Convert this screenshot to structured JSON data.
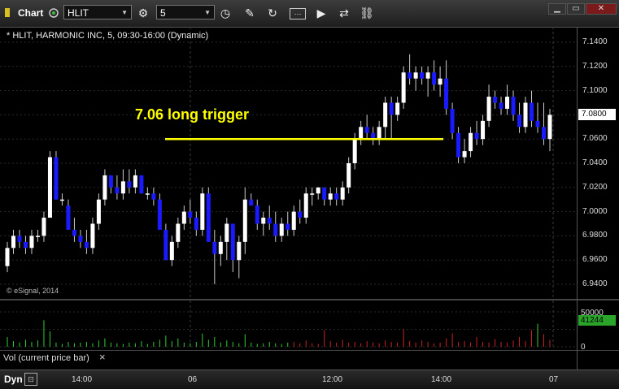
{
  "toolbar": {
    "app_label": "Chart",
    "symbol": "HLIT",
    "interval": "5",
    "icons": [
      "settings-icon",
      "clock-icon",
      "draw-icon",
      "refresh-icon",
      "studies-icon",
      "play-icon",
      "link-icon"
    ]
  },
  "chart": {
    "header": "* HLIT, HARMONIC INC, 5, 09:30-16:00 (Dynamic)",
    "annotation": "7.06 long trigger",
    "copyright": "© eSignal, 2014",
    "current_price": "7.0800",
    "price_ticks": [
      "7.1400",
      "7.1200",
      "7.1000",
      "7.0800",
      "7.0600",
      "7.0400",
      "7.0200",
      "7.0000",
      "6.9800",
      "6.9600",
      "6.9400"
    ],
    "time_ticks": [
      "14:00",
      "06",
      "12:00",
      "14:00",
      "07"
    ],
    "colors": {
      "up": "#ffffff",
      "down": "#1a1aff",
      "trigger": "#ffff00",
      "vol_up": "#33cc33",
      "vol_down": "#cc2222"
    }
  },
  "volume": {
    "label": "Vol (current price bar)",
    "close_symbol": "×",
    "scale_top": "50000",
    "scale_zero": "0",
    "current": "41244"
  },
  "footer": {
    "mode": "Dyn"
  },
  "chart_data": {
    "type": "candlestick",
    "price_range": [
      6.93,
      7.15
    ],
    "candles": [
      [
        6.955,
        6.975,
        6.95,
        6.97
      ],
      [
        6.97,
        6.985,
        6.965,
        6.98
      ],
      [
        6.98,
        6.985,
        6.97,
        6.975
      ],
      [
        6.975,
        6.98,
        6.965,
        6.97
      ],
      [
        6.97,
        6.985,
        6.965,
        6.98
      ],
      [
        6.98,
        6.985,
        6.975,
        6.98
      ],
      [
        6.98,
        7.0,
        6.975,
        6.995
      ],
      [
        6.995,
        7.05,
        6.995,
        7.045
      ],
      [
        7.045,
        7.05,
        7.01,
        7.01
      ],
      [
        7.01,
        7.015,
        7.005,
        7.01
      ],
      [
        7.005,
        7.01,
        6.985,
        6.985
      ],
      [
        6.985,
        6.995,
        6.975,
        6.98
      ],
      [
        6.98,
        6.985,
        6.97,
        6.975
      ],
      [
        6.975,
        6.985,
        6.965,
        6.97
      ],
      [
        6.97,
        6.995,
        6.965,
        6.99
      ],
      [
        6.99,
        7.015,
        6.985,
        7.01
      ],
      [
        7.01,
        7.035,
        7.005,
        7.03
      ],
      [
        7.03,
        7.03,
        7.015,
        7.02
      ],
      [
        7.02,
        7.03,
        7.01,
        7.015
      ],
      [
        7.015,
        7.035,
        7.01,
        7.025
      ],
      [
        7.025,
        7.035,
        7.015,
        7.02
      ],
      [
        7.02,
        7.035,
        7.015,
        7.03
      ],
      [
        7.03,
        7.03,
        7.015,
        7.015
      ],
      [
        7.015,
        7.02,
        7.01,
        7.015
      ],
      [
        7.015,
        7.02,
        7.005,
        7.01
      ],
      [
        7.01,
        7.015,
        6.985,
        6.985
      ],
      [
        6.985,
        6.99,
        6.96,
        6.96
      ],
      [
        6.96,
        6.98,
        6.955,
        6.975
      ],
      [
        6.975,
        6.995,
        6.97,
        6.99
      ],
      [
        6.99,
        7.005,
        6.985,
        7.0
      ],
      [
        7.0,
        7.01,
        6.99,
        6.995
      ],
      [
        6.995,
        7.0,
        6.98,
        6.985
      ],
      [
        6.985,
        7.02,
        6.98,
        7.015
      ],
      [
        7.015,
        7.02,
        6.975,
        6.975
      ],
      [
        6.975,
        6.985,
        6.94,
        6.965
      ],
      [
        6.965,
        6.98,
        6.955,
        6.975
      ],
      [
        6.975,
        6.995,
        6.96,
        6.99
      ],
      [
        6.99,
        6.99,
        6.95,
        6.96
      ],
      [
        6.96,
        6.98,
        6.945,
        6.975
      ],
      [
        6.975,
        7.02,
        6.965,
        7.01
      ],
      [
        7.01,
        7.015,
        7.005,
        7.005
      ],
      [
        7.005,
        7.01,
        6.985,
        6.99
      ],
      [
        6.99,
        7.0,
        6.98,
        6.995
      ],
      [
        6.995,
        7.005,
        6.985,
        6.99
      ],
      [
        6.99,
        7.0,
        6.975,
        6.98
      ],
      [
        6.98,
        6.995,
        6.975,
        6.99
      ],
      [
        6.99,
        7.0,
        6.98,
        6.985
      ],
      [
        6.985,
        7.005,
        6.98,
        7.0
      ],
      [
        7.0,
        7.01,
        6.99,
        6.995
      ],
      [
        6.995,
        7.02,
        6.99,
        7.015
      ],
      [
        7.015,
        7.02,
        7.005,
        7.015
      ],
      [
        7.015,
        7.02,
        7.01,
        7.02
      ],
      [
        7.02,
        7.02,
        7.005,
        7.01
      ],
      [
        7.01,
        7.02,
        7.005,
        7.015
      ],
      [
        7.015,
        7.02,
        7.005,
        7.01
      ],
      [
        7.01,
        7.025,
        7.005,
        7.02
      ],
      [
        7.02,
        7.045,
        7.015,
        7.04
      ],
      [
        7.04,
        7.065,
        7.035,
        7.06
      ],
      [
        7.06,
        7.075,
        7.055,
        7.07
      ],
      [
        7.07,
        7.08,
        7.06,
        7.065
      ],
      [
        7.065,
        7.07,
        7.055,
        7.06
      ],
      [
        7.06,
        7.075,
        7.055,
        7.07
      ],
      [
        7.07,
        7.095,
        7.06,
        7.09
      ],
      [
        7.09,
        7.095,
        7.06,
        7.08
      ],
      [
        7.08,
        7.095,
        7.075,
        7.09
      ],
      [
        7.09,
        7.12,
        7.085,
        7.115
      ],
      [
        7.115,
        7.13,
        7.105,
        7.11
      ],
      [
        7.11,
        7.12,
        7.1,
        7.115
      ],
      [
        7.115,
        7.12,
        7.105,
        7.11
      ],
      [
        7.11,
        7.12,
        7.095,
        7.115
      ],
      [
        7.115,
        7.125,
        7.1,
        7.105
      ],
      [
        7.105,
        7.12,
        7.095,
        7.11
      ],
      [
        7.11,
        7.125,
        7.08,
        7.085
      ],
      [
        7.085,
        7.09,
        7.06,
        7.065
      ],
      [
        7.065,
        7.07,
        7.04,
        7.045
      ],
      [
        7.045,
        7.06,
        7.04,
        7.05
      ],
      [
        7.05,
        7.07,
        7.045,
        7.065
      ],
      [
        7.065,
        7.075,
        7.055,
        7.06
      ],
      [
        7.06,
        7.08,
        7.055,
        7.075
      ],
      [
        7.075,
        7.105,
        7.07,
        7.095
      ],
      [
        7.095,
        7.1,
        7.085,
        7.09
      ],
      [
        7.09,
        7.095,
        7.08,
        7.085
      ],
      [
        7.085,
        7.105,
        7.08,
        7.095
      ],
      [
        7.095,
        7.1,
        7.075,
        7.08
      ],
      [
        7.08,
        7.09,
        7.065,
        7.07
      ],
      [
        7.07,
        7.095,
        7.065,
        7.09
      ],
      [
        7.09,
        7.1,
        7.07,
        7.075
      ],
      [
        7.075,
        7.09,
        7.065,
        7.07
      ],
      [
        7.07,
        7.09,
        7.055,
        7.06
      ],
      [
        7.06,
        7.085,
        7.05,
        7.08
      ]
    ],
    "volume": [
      [
        14000,
        1
      ],
      [
        8000,
        1
      ],
      [
        6000,
        1
      ],
      [
        10000,
        1
      ],
      [
        7000,
        1
      ],
      [
        9000,
        1
      ],
      [
        38000,
        1
      ],
      [
        22000,
        1
      ],
      [
        6000,
        1
      ],
      [
        4000,
        1
      ],
      [
        7000,
        1
      ],
      [
        5000,
        1
      ],
      [
        6000,
        1
      ],
      [
        7000,
        1
      ],
      [
        5000,
        1
      ],
      [
        9000,
        1
      ],
      [
        12000,
        1
      ],
      [
        6000,
        1
      ],
      [
        5000,
        1
      ],
      [
        4000,
        1
      ],
      [
        6000,
        1
      ],
      [
        5000,
        1
      ],
      [
        8000,
        1
      ],
      [
        4000,
        1
      ],
      [
        7000,
        1
      ],
      [
        10000,
        1
      ],
      [
        16000,
        1
      ],
      [
        8000,
        1
      ],
      [
        12000,
        1
      ],
      [
        6000,
        1
      ],
      [
        5000,
        1
      ],
      [
        7000,
        1
      ],
      [
        19000,
        1
      ],
      [
        10000,
        1
      ],
      [
        14000,
        1
      ],
      [
        6000,
        1
      ],
      [
        9000,
        1
      ],
      [
        7000,
        1
      ],
      [
        5000,
        1
      ],
      [
        18000,
        1
      ],
      [
        6000,
        1
      ],
      [
        4000,
        1
      ],
      [
        5000,
        1
      ],
      [
        7000,
        1
      ],
      [
        5000,
        1
      ],
      [
        4000,
        1
      ],
      [
        6000,
        1
      ],
      [
        7000,
        0
      ],
      [
        5000,
        0
      ],
      [
        9000,
        0
      ],
      [
        5000,
        0
      ],
      [
        4000,
        0
      ],
      [
        24000,
        0
      ],
      [
        8000,
        0
      ],
      [
        6000,
        0
      ],
      [
        10000,
        0
      ],
      [
        6000,
        0
      ],
      [
        7000,
        0
      ],
      [
        5000,
        0
      ],
      [
        8000,
        0
      ],
      [
        6000,
        0
      ],
      [
        5000,
        0
      ],
      [
        9000,
        0
      ],
      [
        7000,
        0
      ],
      [
        6000,
        0
      ],
      [
        25000,
        0
      ],
      [
        8000,
        0
      ],
      [
        6000,
        0
      ],
      [
        9000,
        0
      ],
      [
        7000,
        0
      ],
      [
        5000,
        0
      ],
      [
        6000,
        0
      ],
      [
        12000,
        0
      ],
      [
        19000,
        0
      ],
      [
        7000,
        0
      ],
      [
        8000,
        0
      ],
      [
        6000,
        0
      ],
      [
        14000,
        0
      ],
      [
        7000,
        0
      ],
      [
        6000,
        0
      ],
      [
        11000,
        0
      ],
      [
        7000,
        0
      ],
      [
        6000,
        0
      ],
      [
        9000,
        0
      ],
      [
        14000,
        0
      ],
      [
        8000,
        0
      ],
      [
        24000,
        0
      ],
      [
        33000,
        1
      ],
      [
        18000,
        0
      ],
      [
        10000,
        0
      ]
    ]
  }
}
